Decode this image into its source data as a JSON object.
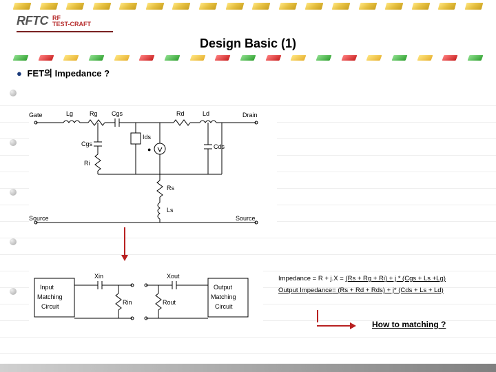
{
  "logo": {
    "main": "RFTC",
    "sub_line1": "RF",
    "sub_line2": "TEST-CRAFT"
  },
  "title": "Design Basic (1)",
  "section": {
    "heading": "FET의 Impedance ?"
  },
  "circuit_top": {
    "gate": "Gate",
    "lg": "Lg",
    "rg": "Rg",
    "cgs": "Cgs",
    "rd": "Rd",
    "ld": "Ld",
    "drain": "Drain",
    "ids": "Ids",
    "cgs2": "Cgs",
    "ri": "Ri",
    "cds": "Cds",
    "rs": "Rs",
    "ls": "Ls",
    "source_l": "Source",
    "source_r": "Source",
    "gm_marker": "●"
  },
  "circuit_bottom": {
    "input_match": "Input\nMatching\nCircuit",
    "output_match": "Output\nMatching\nCircuit",
    "xin": "Xin",
    "xout": "Xout",
    "rin": "Rin",
    "rout": "Rout"
  },
  "equations": {
    "line1_pre": "Impedance = R + j.X = ",
    "line1_u": "(Rs + Rg + Ri) + j * (Cgs + Ls +Lg)",
    "line2_pre": "Output Impedance",
    "line2_u": "= (Rs + Rd + Rds) + j* (Cds + Ls + Ld)"
  },
  "howto": "How to matching ?"
}
